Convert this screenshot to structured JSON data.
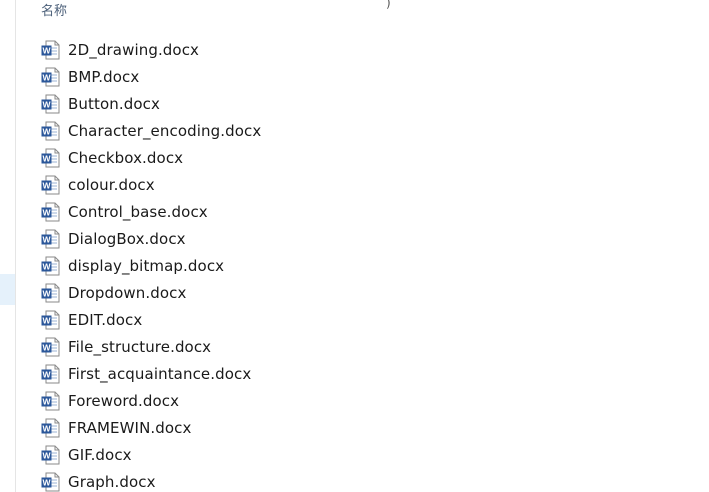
{
  "top_mark": ")",
  "header": {
    "name_column": "名称"
  },
  "icon": "word-document-icon",
  "files": [
    "2D_drawing.docx",
    "BMP.docx",
    "Button.docx",
    "Character_encoding.docx",
    "Checkbox.docx",
    "colour.docx",
    "Control_base.docx",
    "DialogBox.docx",
    "display_bitmap.docx",
    "Dropdown.docx",
    "EDIT.docx",
    "File_structure.docx",
    "First_acquaintance.docx",
    "Foreword.docx",
    "FRAMEWIN.docx",
    "GIF.docx",
    "Graph.docx"
  ],
  "colors": {
    "word_blue": "#2b579a",
    "header_text": "#4c607a",
    "nav_highlight": "#e5f1fb"
  }
}
